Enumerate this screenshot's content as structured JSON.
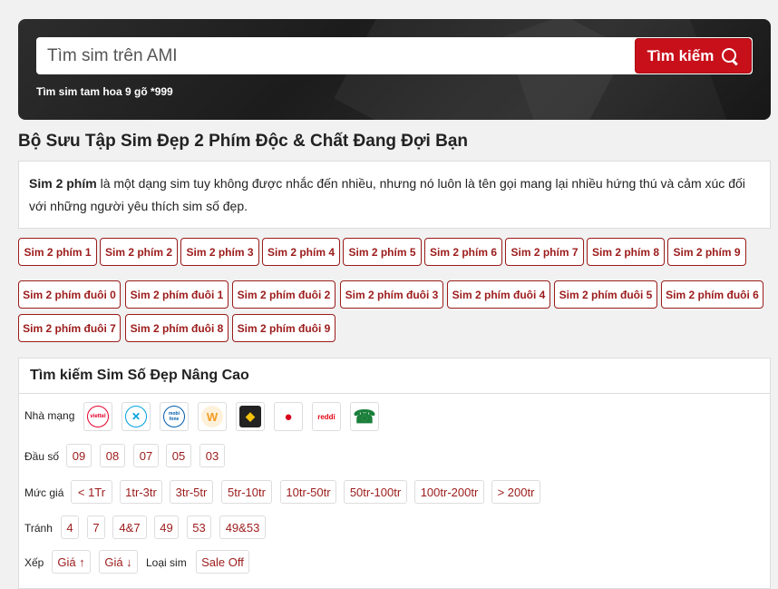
{
  "search": {
    "placeholder": "Tìm sim trên AMI",
    "button_label": "Tìm kiếm",
    "hint": "Tìm sim tam hoa 9 gõ *999"
  },
  "page_title": "Bộ Sưu Tập Sim Đẹp 2 Phím Độc & Chất Đang Đợi Bạn",
  "intro": {
    "bold": "Sim 2 phím",
    "text": " là một dạng sim tuy không được nhắc đến nhiều, nhưng nó luôn là tên gọi mang lại nhiều hứng thú và cảm xúc đối với những người yêu thích sim số đẹp."
  },
  "tags_row1": [
    "Sim 2 phím 1",
    "Sim 2 phím 2",
    "Sim 2 phím 3",
    "Sim 2 phím 4",
    "Sim 2 phím 5",
    "Sim 2 phím 6",
    "Sim 2 phím 7",
    "Sim 2 phím 8",
    "Sim 2 phím 9"
  ],
  "tags_row2": [
    "Sim 2 phím đuôi 0",
    "Sim 2 phím đuôi 1",
    "Sim 2 phím đuôi 2",
    "Sim 2 phím đuôi 3",
    "Sim 2 phím đuôi 4",
    "Sim 2 phím đuôi 5",
    "Sim 2 phím đuôi 6"
  ],
  "tags_row3": [
    "Sim 2 phím đuôi 7",
    "Sim 2 phím đuôi 8",
    "Sim 2 phím đuôi 9"
  ],
  "advanced": {
    "title": "Tìm kiếm Sim Số Đẹp Nâng Cao",
    "network_label": "Nhà mạng",
    "networks": [
      {
        "icon": "viettel-icon",
        "text": "viettel",
        "color": "#e4002b"
      },
      {
        "icon": "vietnamobile-icon",
        "text": "✕",
        "color": "#00a0e0"
      },
      {
        "icon": "mobifone-icon",
        "text": "mobi fone",
        "color": "#005bab"
      },
      {
        "icon": "wintel-icon",
        "text": "W",
        "color": "#f29c1f"
      },
      {
        "icon": "gmobile-icon",
        "text": "◆",
        "color": "#d4a300"
      },
      {
        "icon": "itelecom-icon",
        "text": "●",
        "color": "#d6001c"
      },
      {
        "icon": "reddi-icon",
        "text": "reddi",
        "color": "#e30613"
      },
      {
        "icon": "landline-phone-icon",
        "text": "☎",
        "color": "#1a7f3a"
      }
    ],
    "prefix_label": "Đầu số",
    "prefixes": [
      "09",
      "08",
      "07",
      "05",
      "03"
    ],
    "price_label": "Mức giá",
    "prices": [
      "< 1Tr",
      "1tr-3tr",
      "3tr-5tr",
      "5tr-10tr",
      "10tr-50tr",
      "50tr-100tr",
      "100tr-200tr",
      "> 200tr"
    ],
    "avoid_label": "Tránh",
    "avoid": [
      "4",
      "7",
      "4&7",
      "49",
      "53",
      "49&53"
    ],
    "sort_label": "Xếp",
    "sort": [
      "Giá ↑",
      "Giá ↓"
    ],
    "type_label": "Loại sim",
    "types": [
      "Sale Off"
    ]
  }
}
